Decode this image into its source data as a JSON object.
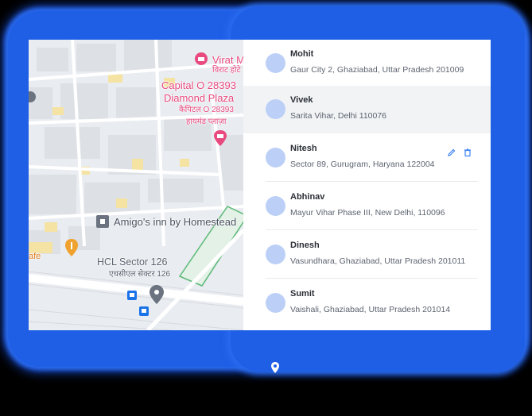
{
  "map": {
    "labels": {
      "hotel_en": "Virat M",
      "hotel_hi": "विराट होटे",
      "capital_en_1": "Capital O 28393",
      "capital_en_2": "Diamond Plaza",
      "capital_hi_1": "कैपिटल O 28393",
      "capital_hi_2": "हायमंड प्लाज़ा",
      "amigos": "Amigo's inn by Homestead",
      "cafe": "afe",
      "hcl_en": "HCL Sector 126",
      "hcl_hi": "एचसीएल सेक्टर 126"
    },
    "colors": {
      "brand_pink": "#e84a7f",
      "poi_orange": "#f0a22e",
      "poi_blue": "#1a73e8",
      "road_green": "#5bb978"
    },
    "icons": [
      "hotel-icon",
      "restaurant-icon",
      "lodging-icon",
      "bus-stop-icon",
      "location-pin-icon"
    ]
  },
  "contacts": [
    {
      "name": "Mohit",
      "address": "Gaur City 2, Ghaziabad, Uttar Pradesh 201009"
    },
    {
      "name": "Vivek",
      "address": "Sarita Vihar, Delhi 110076"
    },
    {
      "name": "Nitesh",
      "address": "Sector 89, Gurugram, Haryana 122004"
    },
    {
      "name": "Abhinav",
      "address": "Mayur Vihar Phase III, New Delhi,  110096"
    },
    {
      "name": "Dinesh",
      "address": "Vasundhara, Ghaziabad, Uttar Pradesh 201011"
    },
    {
      "name": "Sumit",
      "address": "Vaishali, Ghaziabad, Uttar Pradesh 201014"
    }
  ],
  "colors": {
    "glow": "#1f5fe6",
    "avatar": "#bcd0f7",
    "row_hover": "#f1f3f5",
    "action_icons": "#3b82f6"
  }
}
